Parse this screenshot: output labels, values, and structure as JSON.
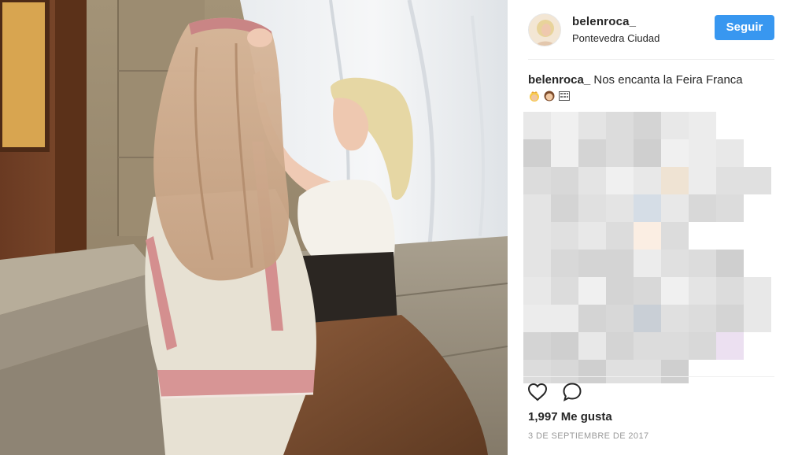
{
  "post": {
    "username": "belenroca_",
    "location": "Pontevedra Ciudad",
    "follow_label": "Seguir",
    "caption_user": "belenroca_",
    "caption_text": " Nos encanta la Feira Franca",
    "emojis": [
      "princess-emoji",
      "person-emoji",
      "bottle-label-emoji"
    ],
    "likes": "1,997 Me gusta",
    "date": "3 DE SEPTIEMBRE DE 2017"
  },
  "icons": {
    "like": "heart-outline-icon",
    "comment": "speech-bubble-icon"
  },
  "colors": {
    "accent": "#3897f0",
    "text": "#262626",
    "muted": "#999999"
  }
}
